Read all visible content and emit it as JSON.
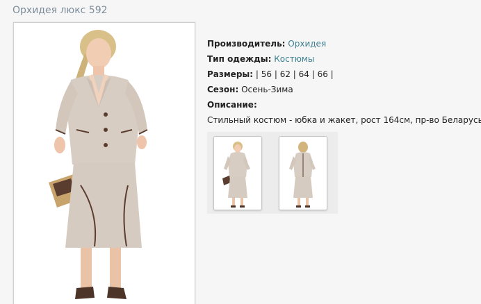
{
  "product": {
    "title": "Орхидея люкс 592"
  },
  "details": {
    "manufacturer_label": "Производитель:",
    "manufacturer_value": "Орхидея",
    "type_label": "Тип одежды:",
    "type_value": "Костюмы",
    "sizes_label": "Размеры:",
    "sizes_value": "| 56 | 62 | 64 | 66 |",
    "season_label": "Сезон:",
    "season_value": "Осень-Зима",
    "description_label": "Описание:",
    "description_value": "Стильный костюм - юбка и жакет, рост 164см, пр-во Беларусь"
  },
  "colors": {
    "title": "#7d8c9a",
    "link": "#3e7f8f",
    "suit": "#d8cdc3",
    "trim": "#5a3d2e"
  },
  "thumbnails": [
    {
      "icon": "model-front-photo"
    },
    {
      "icon": "model-back-photo"
    }
  ]
}
